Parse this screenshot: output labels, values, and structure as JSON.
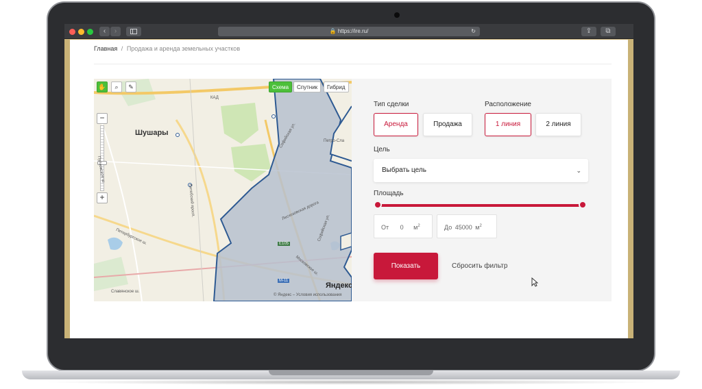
{
  "browser": {
    "url": "https://ire.ru/"
  },
  "breadcrumb": {
    "home": "Главная",
    "separator": "/",
    "current": "Продажа и аренда земельных участков"
  },
  "map": {
    "tabs": [
      {
        "label": "Схема",
        "active": true
      },
      {
        "label": "Спутник"
      },
      {
        "label": "Гибрид"
      }
    ],
    "labels": {
      "town": "Шушары",
      "petro": "Петро-Сла",
      "kad": "КАД",
      "sofiyskaya": "Софийская ул.",
      "sofiyskaya2": "Софийская ул.",
      "leskhoz": "Лесхозовская дорога",
      "moskovskoe": "Московское ш.",
      "vitebsky": "Витебский просп.",
      "peterburgskoe": "Петербургское ш.",
      "pulkovskoe": "Пулковское ш.",
      "slavyanskoe": "Славянское ш.",
      "road_e105": "E105",
      "road_m11": "М-11",
      "brand": "Яндекс",
      "copyright": "© Яндекс – Условия использования"
    },
    "zoom_plus": "+",
    "zoom_minus": "−"
  },
  "filters": {
    "deal_type_label": "Тип сделки",
    "deal_types": [
      {
        "label": "Аренда",
        "selected": true
      },
      {
        "label": "Продажа",
        "selected": false
      }
    ],
    "location_label": "Расположение",
    "locations": [
      {
        "label": "1 линия",
        "selected": true
      },
      {
        "label": "2 линия",
        "selected": false
      }
    ],
    "purpose_label": "Цель",
    "purpose_value": "Выбрать цель",
    "area_label": "Площадь",
    "area_from_prefix": "От",
    "area_from_value": "0",
    "area_to_prefix": "До",
    "area_to_value": "45000",
    "unit": "м",
    "unit_sup": "2",
    "submit_label": "Показать",
    "reset_label": "Сбросить фильтр"
  },
  "colors": {
    "accent": "#c8183a",
    "map_active_tab": "#4cbf3a",
    "polygon_fill": "#b7c1cf",
    "polygon_stroke": "#2e5a92"
  }
}
